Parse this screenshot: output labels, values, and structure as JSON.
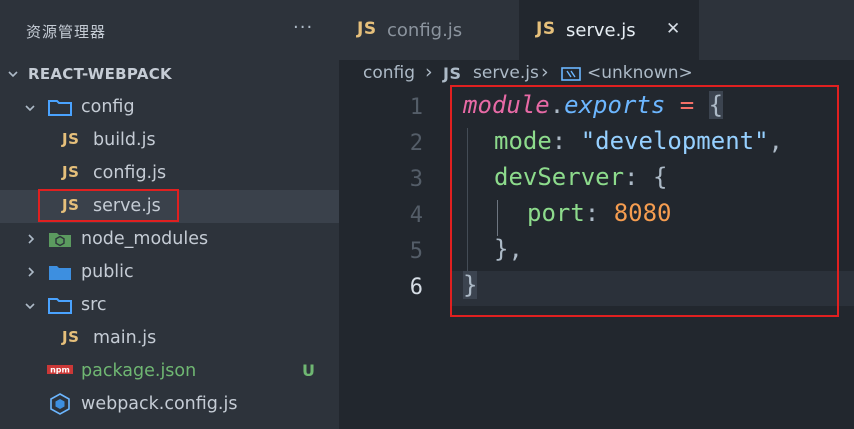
{
  "explorer": {
    "title": "资源管理器",
    "more": "···",
    "project": "REACT-WEBPACK",
    "items": [
      {
        "label": "config",
        "kind": "folder",
        "expanded": true
      },
      {
        "label": "build.js",
        "kind": "js"
      },
      {
        "label": "config.js",
        "kind": "js"
      },
      {
        "label": "serve.js",
        "kind": "js",
        "selected": true
      },
      {
        "label": "node_modules",
        "kind": "folder",
        "expanded": false
      },
      {
        "label": "public",
        "kind": "folder",
        "expanded": false
      },
      {
        "label": "src",
        "kind": "folder",
        "expanded": true
      },
      {
        "label": "main.js",
        "kind": "js"
      },
      {
        "label": "package.json",
        "kind": "npm",
        "badge": "U"
      },
      {
        "label": "webpack.config.js",
        "kind": "webpack"
      }
    ]
  },
  "tabs": [
    {
      "icon": "JS",
      "label": "config.js",
      "active": false
    },
    {
      "icon": "JS",
      "label": "serve.js",
      "active": true,
      "close": "✕"
    }
  ],
  "breadcrumb": {
    "folder": "config",
    "sep": "›",
    "icon": "JS",
    "file": "serve.js",
    "symbol": "<unknown>"
  },
  "editor": {
    "line_numbers": [
      "1",
      "2",
      "3",
      "4",
      "5",
      "6"
    ],
    "active_line": "6",
    "line1": {
      "mod": "module",
      "dot": ".",
      "exp": "exports",
      "eq": " = ",
      "brace": "{"
    },
    "line2": {
      "key": "mode",
      "colon": ": ",
      "val": "\"development\"",
      "comma": ","
    },
    "line3": {
      "key": "devServer",
      "colon": ": ",
      "brace": "{"
    },
    "line4": {
      "key": "port",
      "colon": ": ",
      "val": "8080"
    },
    "line5": {
      "text": "},"
    },
    "line6": {
      "brace": "}"
    }
  },
  "colors": {
    "sidebar_bg": "#2d333b",
    "editor_bg": "#22272e",
    "highlight_box": "#e02020",
    "js_icon": "#e6c07b",
    "git_untracked": "#6fb772"
  }
}
